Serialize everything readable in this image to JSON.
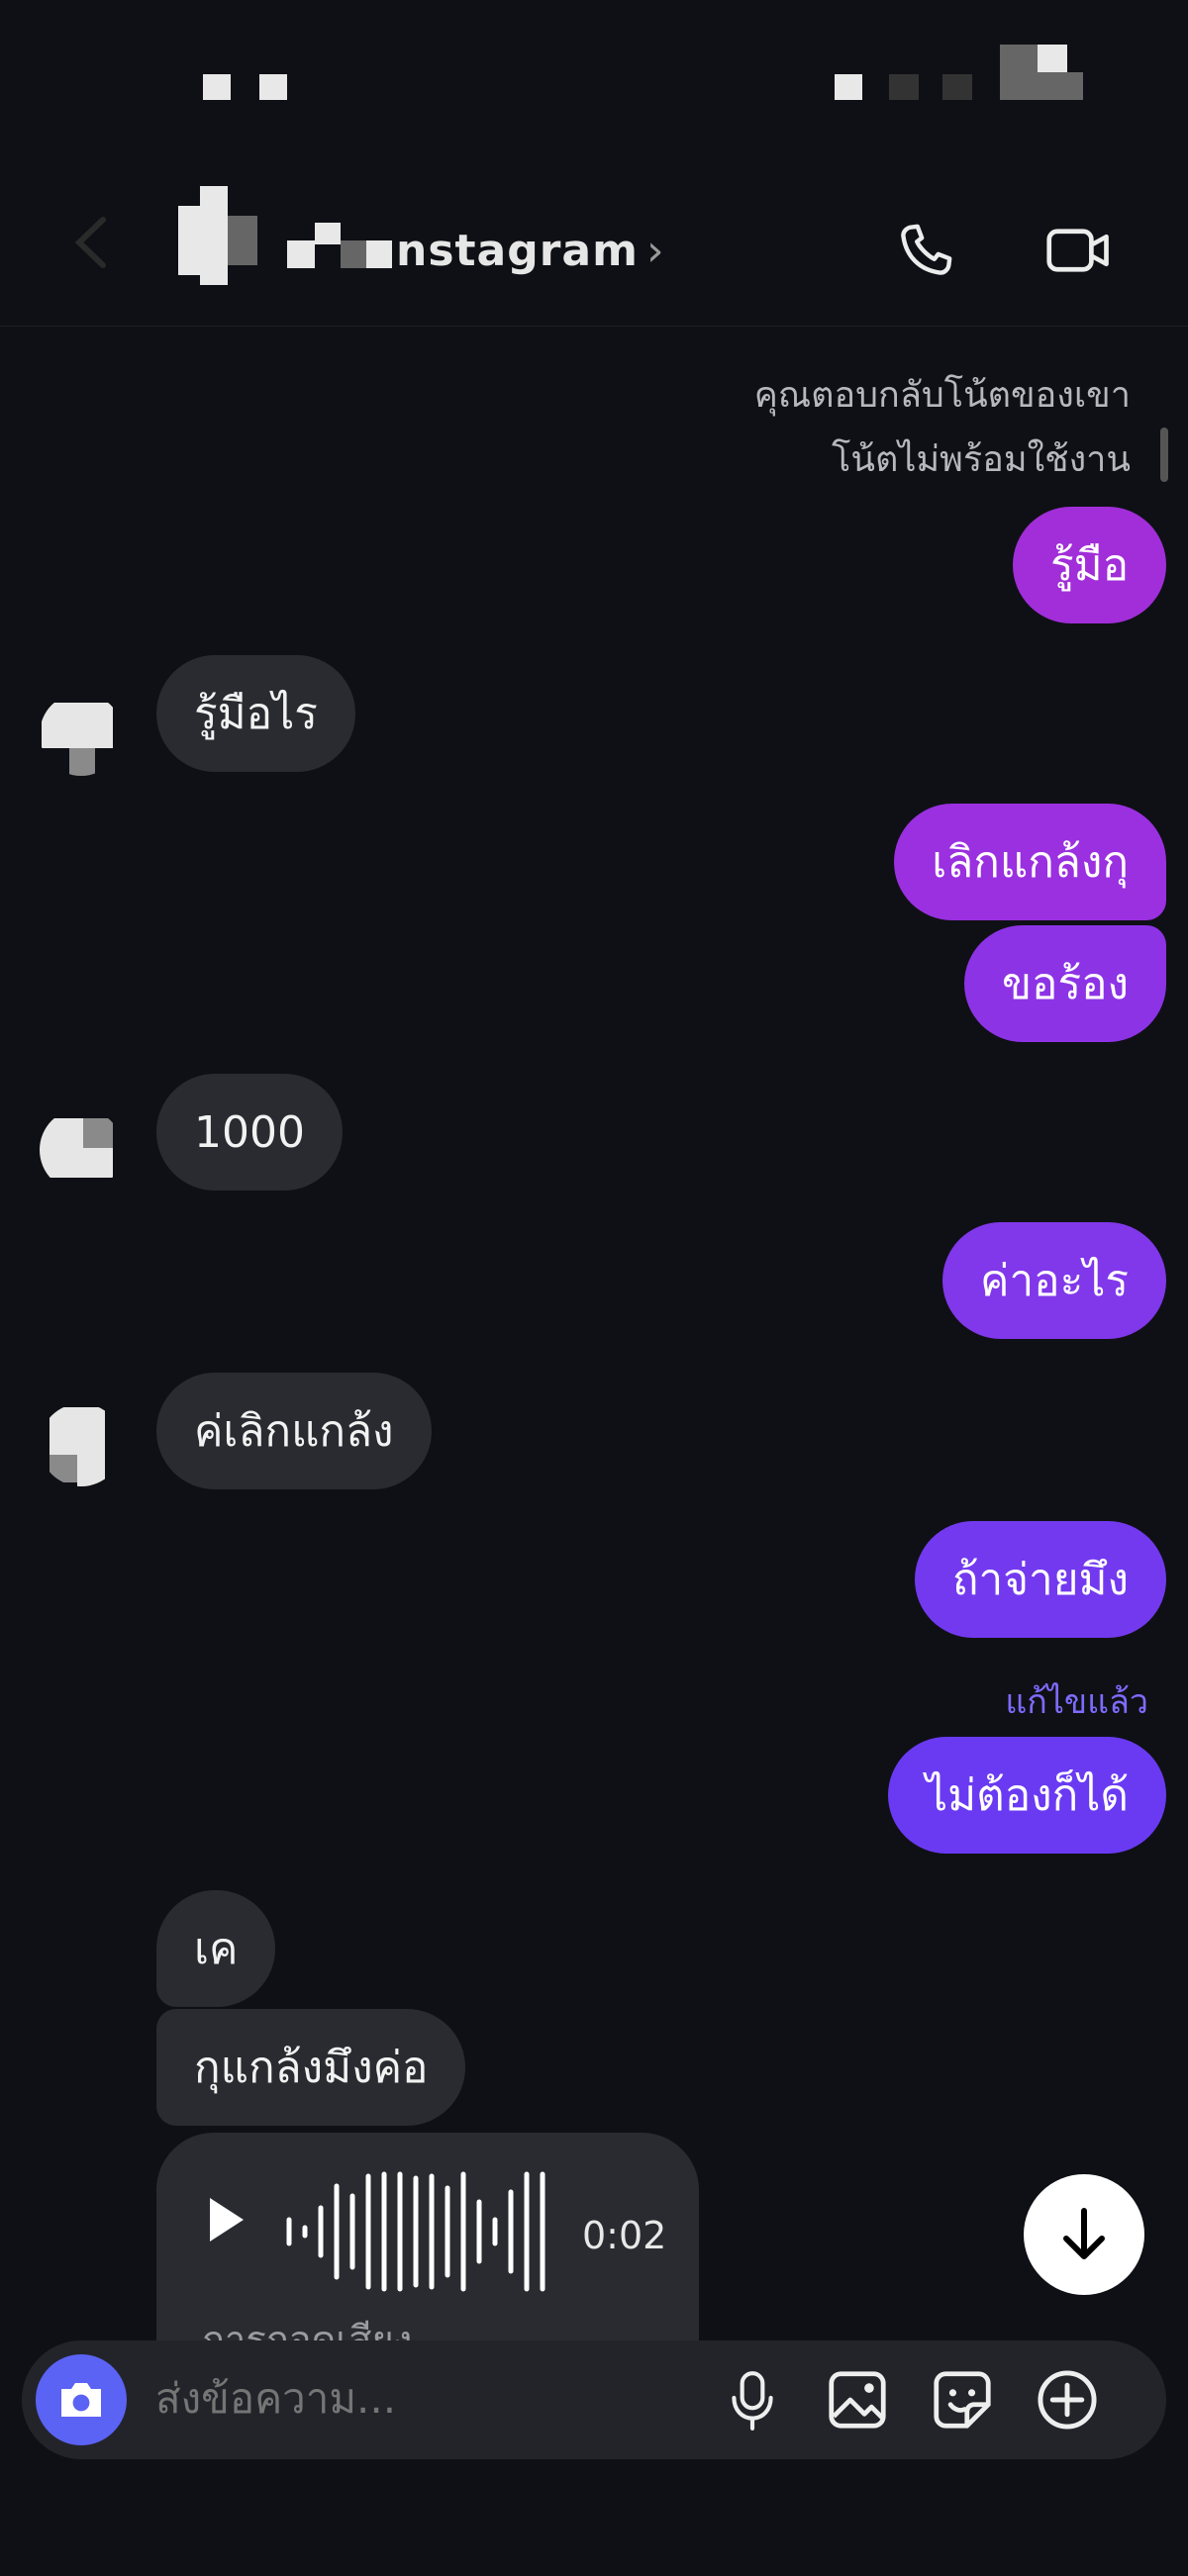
{
  "header": {
    "title": "nstagram",
    "chevron": "›",
    "call_icon": "phone-icon",
    "video_icon": "video-call-icon"
  },
  "notices": {
    "reply_note": "คุณตอบกลับโน้ตของเขา",
    "note_unavailable": "โน้ตไม่พร้อมใช้งาน"
  },
  "messages": [
    {
      "from": "me",
      "text": "รู้มือ"
    },
    {
      "from": "them",
      "text": "รู้มือไร"
    },
    {
      "from": "me",
      "text": "เลิกแกล้งกุ"
    },
    {
      "from": "me",
      "text": "ขอร้อง"
    },
    {
      "from": "them",
      "text": "1000"
    },
    {
      "from": "me",
      "text": "ค่าอะไร"
    },
    {
      "from": "them",
      "text": "ค่เลิกแกล้ง"
    },
    {
      "from": "me",
      "text": "ถ้าจ่ายมึง"
    },
    {
      "from": "me",
      "text": "ไม่ต้องก็ได้",
      "edited_label": "แก้ไขแล้ว"
    },
    {
      "from": "them",
      "text": "เค"
    },
    {
      "from": "them",
      "text": "กุแกล้งมึงค่อ"
    }
  ],
  "voice_message": {
    "duration": "0:02",
    "caption": "การถอดเสียง"
  },
  "composer": {
    "placeholder": "ส่งข้อความ...",
    "icons": [
      "camera-icon",
      "microphone-icon",
      "gallery-icon",
      "sticker-icon",
      "plus-icon"
    ]
  },
  "colors": {
    "background": "#0f1015",
    "incoming_bubble": "#2a2b31",
    "outgoing_bubble_top": "#9b2fe0",
    "outgoing_bubble_bottom": "#6a39f3",
    "edited_label": "#7d6bff",
    "camera_button": "#5b63f5"
  }
}
